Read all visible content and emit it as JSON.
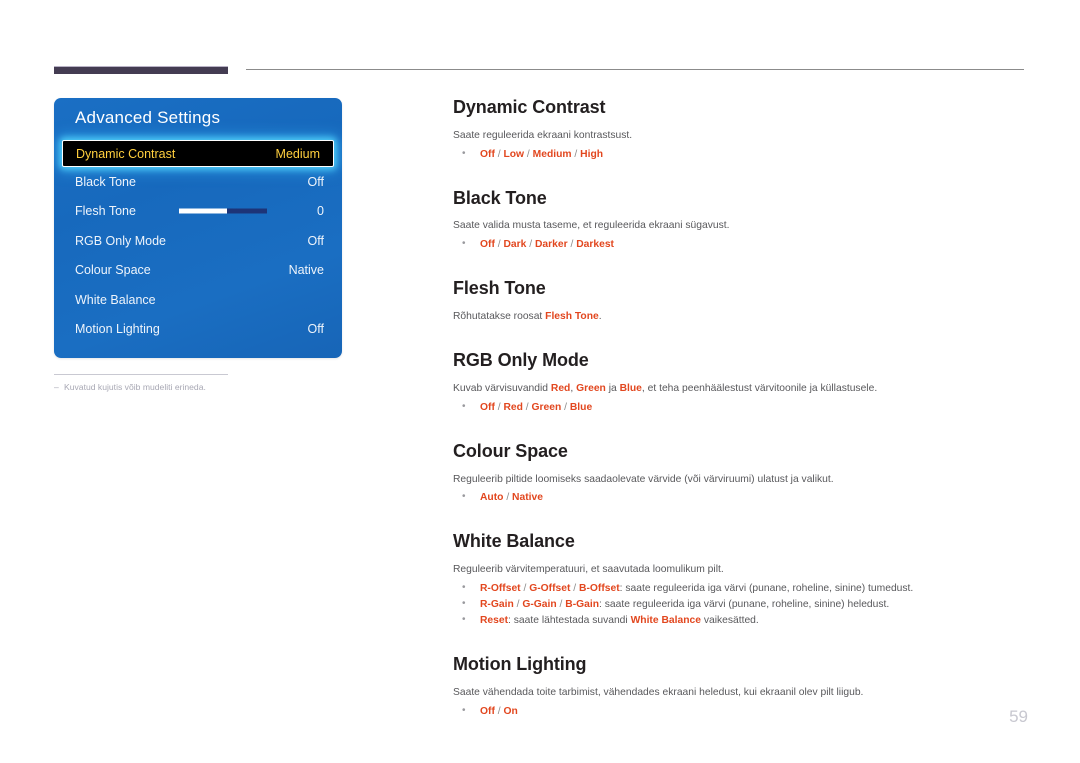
{
  "page": {
    "number": "59"
  },
  "osd": {
    "title": "Advanced Settings",
    "rows": [
      {
        "label": "Dynamic Contrast",
        "value": "Medium",
        "highlighted": true
      },
      {
        "label": "Black Tone",
        "value": "Off"
      },
      {
        "label": "Flesh Tone",
        "value": "0",
        "slider": 55
      },
      {
        "label": "RGB Only Mode",
        "value": "Off"
      },
      {
        "label": "Colour Space",
        "value": "Native"
      },
      {
        "label": "White Balance",
        "value": ""
      },
      {
        "label": "Motion Lighting",
        "value": "Off"
      }
    ]
  },
  "footnote": {
    "marker": "‒",
    "text": "Kuvatud kujutis võib mudeliti erineda."
  },
  "sections": [
    {
      "heading": "Dynamic Contrast",
      "desc": "Saate reguleerida ekraani kontrastsust.",
      "bullets": [
        {
          "options": [
            "Off",
            "Low",
            "Medium",
            "High"
          ],
          "separator": " / "
        }
      ]
    },
    {
      "heading": "Black Tone",
      "desc": "Saate valida musta taseme, et reguleerida ekraani sügavust.",
      "bullets": [
        {
          "options": [
            "Off",
            "Dark",
            "Darker",
            "Darkest"
          ],
          "separator": " / "
        }
      ]
    },
    {
      "heading": "Flesh Tone",
      "desc_parts": [
        {
          "text": "Rõhutatakse roosat ",
          "accent": false
        },
        {
          "text": "Flesh Tone",
          "accent": true
        },
        {
          "text": ".",
          "accent": false
        }
      ],
      "bullets": []
    },
    {
      "heading": "RGB Only Mode",
      "desc_parts": [
        {
          "text": "Kuvab värvisuvandid ",
          "accent": false
        },
        {
          "text": "Red",
          "accent": true
        },
        {
          "text": ", ",
          "accent": false
        },
        {
          "text": "Green",
          "accent": true
        },
        {
          "text": " ja ",
          "accent": false
        },
        {
          "text": "Blue",
          "accent": true
        },
        {
          "text": ", et teha peenhäälestust värvitoonile ja küllastusele.",
          "accent": false
        }
      ],
      "bullets": [
        {
          "options": [
            "Off",
            "Red",
            "Green",
            "Blue"
          ],
          "separator": " / "
        }
      ]
    },
    {
      "heading": "Colour Space",
      "desc": "Reguleerib piltide loomiseks saadaolevate värvide (või värviruumi) ulatust ja valikut.",
      "bullets": [
        {
          "options": [
            "Auto",
            "Native"
          ],
          "separator": " / "
        }
      ]
    },
    {
      "heading": "White Balance",
      "desc": "Reguleerib värvitemperatuuri, et saavutada loomulikum pilt.",
      "bullets": [
        {
          "options": [
            "R-Offset",
            "G-Offset",
            "B-Offset"
          ],
          "separator": " / ",
          "tail": ": saate reguleerida iga värvi (punane, roheline, sinine) tumedust."
        },
        {
          "options": [
            "R-Gain",
            "G-Gain",
            "B-Gain"
          ],
          "separator": " / ",
          "tail": ": saate reguleerida iga värvi (punane, roheline, sinine) heledust."
        },
        {
          "options": [
            "Reset"
          ],
          "separator": " / ",
          "tail": ": saate lähtestada suvandi ",
          "tail_parts": [
            {
              "text": ": saate lähtestada suvandi ",
              "accent": false
            },
            {
              "text": "White Balance",
              "accent": true
            },
            {
              "text": " vaikesätted.",
              "accent": false
            }
          ]
        }
      ]
    },
    {
      "heading": "Motion Lighting",
      "desc": "Saate vähendada toite tarbimist, vähendades ekraani heledust, kui ekraanil olev pilt liigub.",
      "bullets": [
        {
          "options": [
            "Off",
            "On"
          ],
          "separator": " / "
        }
      ]
    }
  ],
  "colors": {
    "accent_orange": "#e2471f",
    "osd_blue": "#1769bd",
    "osd_highlight_text": "#ffcf3e",
    "rule_dark": "#443c52",
    "body_text": "#58585b"
  }
}
